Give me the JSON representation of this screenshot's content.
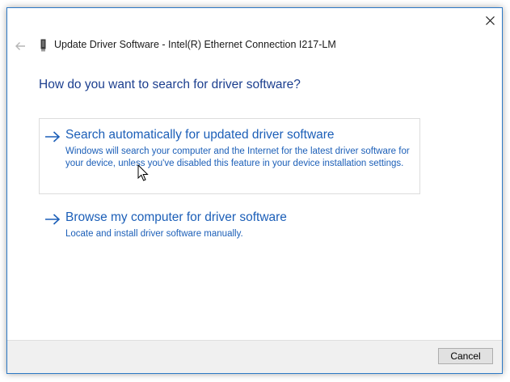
{
  "window": {
    "title": "Update Driver Software - Intel(R) Ethernet Connection I217-LM",
    "icons": {
      "back": "back-arrow-icon",
      "device": "network-device-icon",
      "close": "close-icon"
    }
  },
  "heading": "How do you want to search for driver software?",
  "options": [
    {
      "title": "Search automatically for updated driver software",
      "description": "Windows will search your computer and the Internet for the latest driver software for your device, unless you've disabled this feature in your device installation settings.",
      "icon": "arrow-right-icon"
    },
    {
      "title": "Browse my computer for driver software",
      "description": "Locate and install driver software manually.",
      "icon": "arrow-right-icon"
    }
  ],
  "footer": {
    "cancel_label": "Cancel"
  },
  "colors": {
    "link": "#1c5fb8",
    "heading": "#1c3f8f",
    "accent_border": "#2b78c5"
  }
}
